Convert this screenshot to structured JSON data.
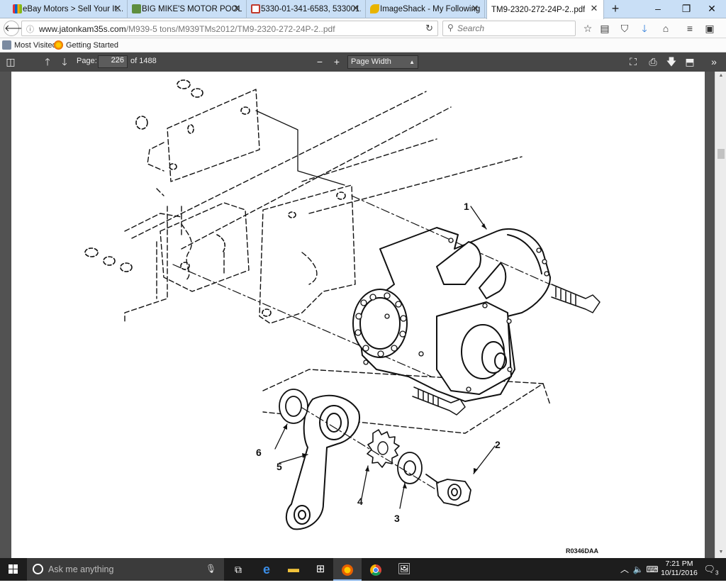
{
  "tabs": [
    {
      "label": "eBay Motors > Sell Your It...",
      "icon": "ebay-icon",
      "color": "#e53238"
    },
    {
      "label": "BIG MIKE'S MOTOR POOL...",
      "icon": "shopify-icon",
      "color": "#5e8e3e"
    },
    {
      "label": "5330-01-341-6583, 533001...",
      "icon": "parts-icon",
      "color": "#c0392b"
    },
    {
      "label": "ImageShack - My Following",
      "icon": "imageshack-icon",
      "color": "#e8b400"
    },
    {
      "label": "TM9-2320-272-24P-2..pdf",
      "icon": "pdf-icon",
      "color": ""
    }
  ],
  "url": {
    "host": "www.jatonkam35s.com",
    "path": "/M939-5 tons/M939TMs2012/TM9-2320-272-24P-2..pdf"
  },
  "search": {
    "placeholder": "Search"
  },
  "bookmarks": [
    {
      "label": "Most Visited",
      "icon": "gear-bookmark-icon"
    },
    {
      "label": "Getting Started",
      "icon": "firefox-icon"
    }
  ],
  "pdf": {
    "page_label": "Page:",
    "page_value": "226",
    "page_count": "of 1488",
    "zoom": "Page Width"
  },
  "figure": {
    "callouts": [
      "1",
      "2",
      "3",
      "4",
      "5",
      "6"
    ],
    "code": "R0346DAA"
  },
  "taskbar": {
    "search_placeholder": "Ask me anything",
    "time": "7:21 PM",
    "date": "10/11/2016",
    "notifications": "3"
  }
}
